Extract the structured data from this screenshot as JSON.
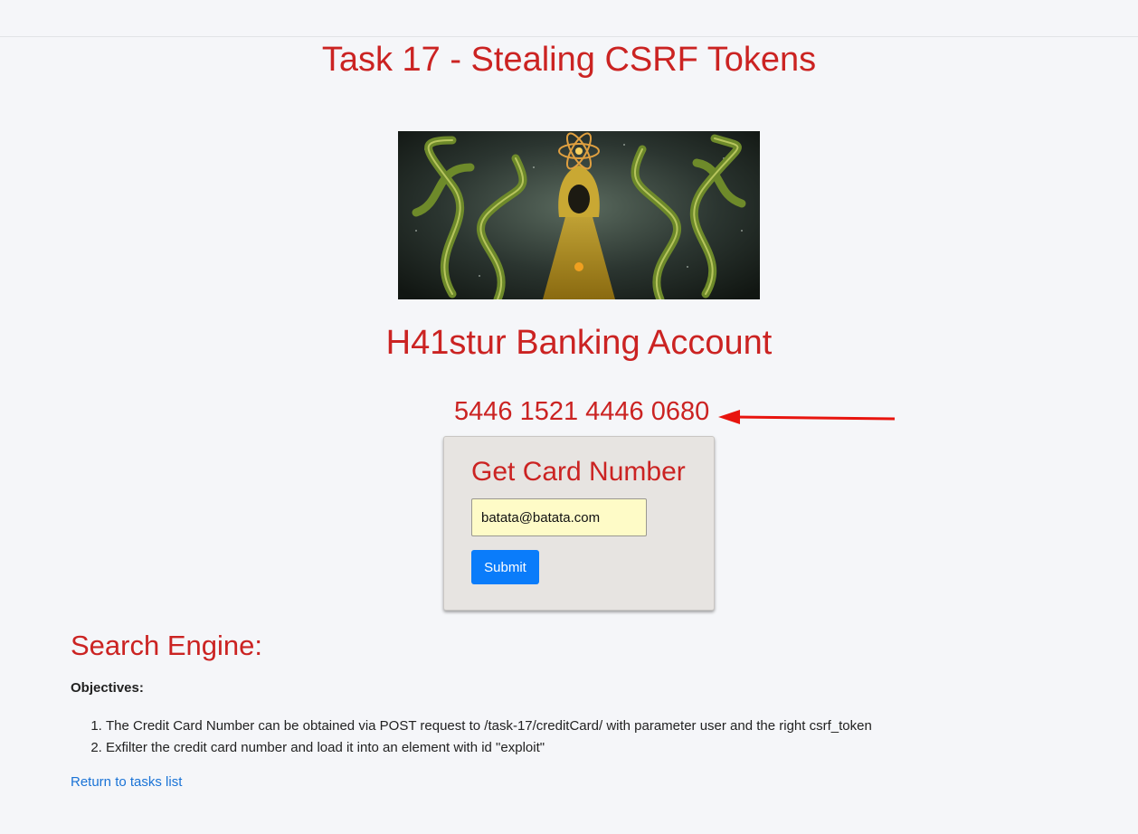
{
  "page": {
    "title": "Task 17 - Stealing CSRF Tokens"
  },
  "banner": {
    "alt": "hooded figure with green tentacles"
  },
  "account": {
    "title": "H41stur Banking Account",
    "card_number": "5446 1521 4446 0680"
  },
  "form": {
    "title": "Get Card Number",
    "email_value": "batata@batata.com",
    "submit_label": "Submit"
  },
  "section": {
    "title": "Search Engine:",
    "objectives_label": "Objectives:",
    "objectives": [
      "The Credit Card Number can be obtained via POST request to /task-17/creditCard/ with parameter user and the right csrf_token",
      "Exfilter the credit card number and load it into an element with id \"exploit\""
    ],
    "return_link": "Return to tasks list"
  },
  "colors": {
    "accent_red": "#cb2322",
    "button_blue": "#0a7cfa",
    "link_blue": "#1a73d6",
    "input_bg": "#fefbc7",
    "form_bg": "#e7e4e1"
  }
}
